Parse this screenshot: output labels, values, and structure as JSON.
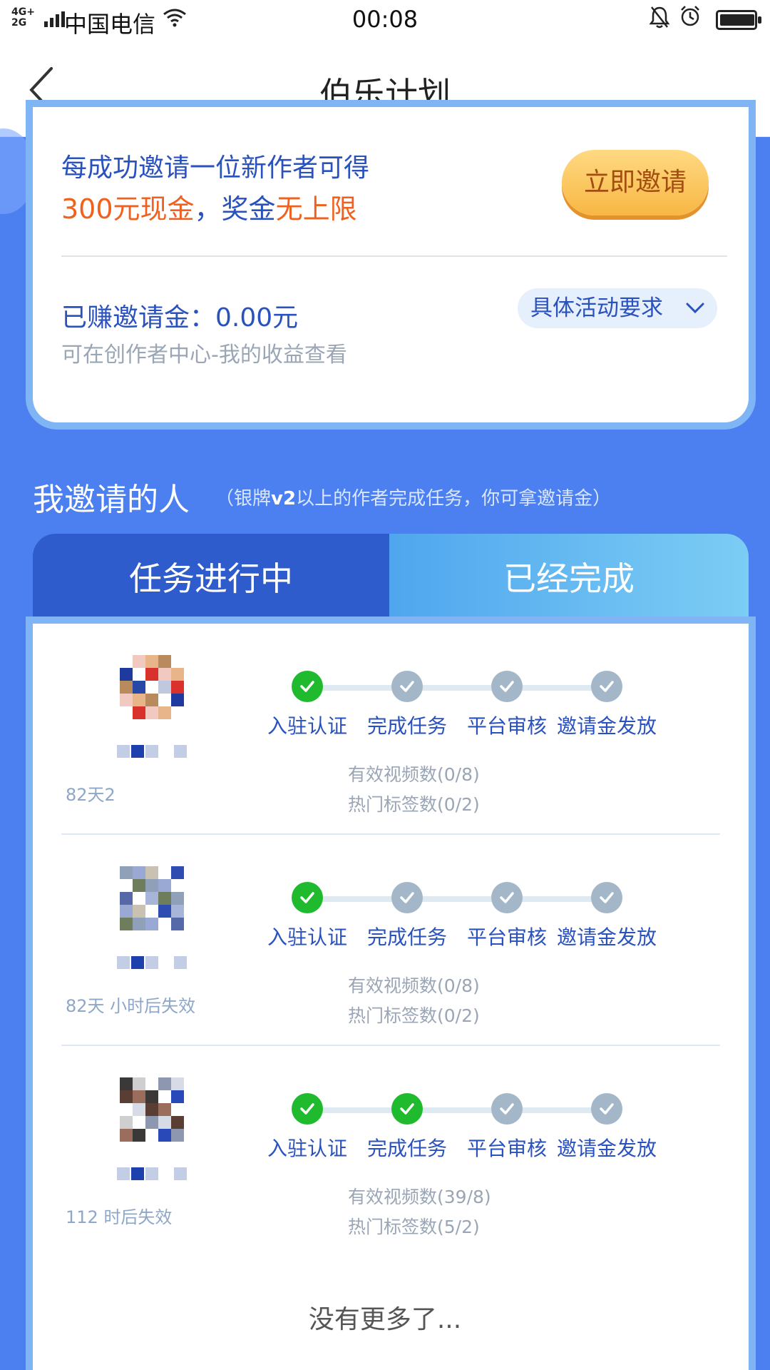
{
  "status_bar": {
    "network": "4G+ 2G",
    "carrier": "中国电信",
    "time": "00:08",
    "icons": [
      "signal-icon",
      "wifi-icon",
      "bell-muted-icon",
      "alarm-icon",
      "battery-icon"
    ]
  },
  "nav": {
    "title": "伯乐计划",
    "back_icon": "chevron-left-icon"
  },
  "invite_card": {
    "line1": "每成功邀请一位新作者可得",
    "reward_amount": "300元现金",
    "sep": "，",
    "bonus_prefix": "奖金",
    "bonus_suffix": "无上限",
    "invite_button": "立即邀请",
    "earned": "已赚邀请金：0.00元",
    "earned_hint": "可在创作者中心-我的收益查看",
    "requirements_button": "具体活动要求"
  },
  "section": {
    "title": "我邀请的人",
    "note_open": "（银牌",
    "note_badge": "v2",
    "note_rest": "以上的作者完成任务，你可拿邀请金）"
  },
  "tabs": {
    "in_progress": "任务进行中",
    "completed": "已经完成"
  },
  "steps_labels": [
    "入驻认证",
    "完成任务",
    "平台审核",
    "邀请金发放"
  ],
  "invitees": [
    {
      "expire_text": "82天2",
      "steps_done": [
        true,
        false,
        false,
        false
      ],
      "videos": "有效视频数(0/8)",
      "tags": "热门标签数(0/2)"
    },
    {
      "expire_text": "82天 小时后失效",
      "steps_done": [
        true,
        false,
        false,
        false
      ],
      "videos": "有效视频数(0/8)",
      "tags": "热门标签数(0/2)"
    },
    {
      "expire_text": "112 时后失效",
      "steps_done": [
        true,
        true,
        false,
        false
      ],
      "videos": "有效视频数(39/8)",
      "tags": "热门标签数(5/2)"
    }
  ],
  "footer": {
    "no_more": "没有更多了..."
  },
  "colors": {
    "background": "#4c80f0",
    "accent_blue": "#2a52be",
    "orange": "#f0611f",
    "done_green": "#1fba2e"
  }
}
